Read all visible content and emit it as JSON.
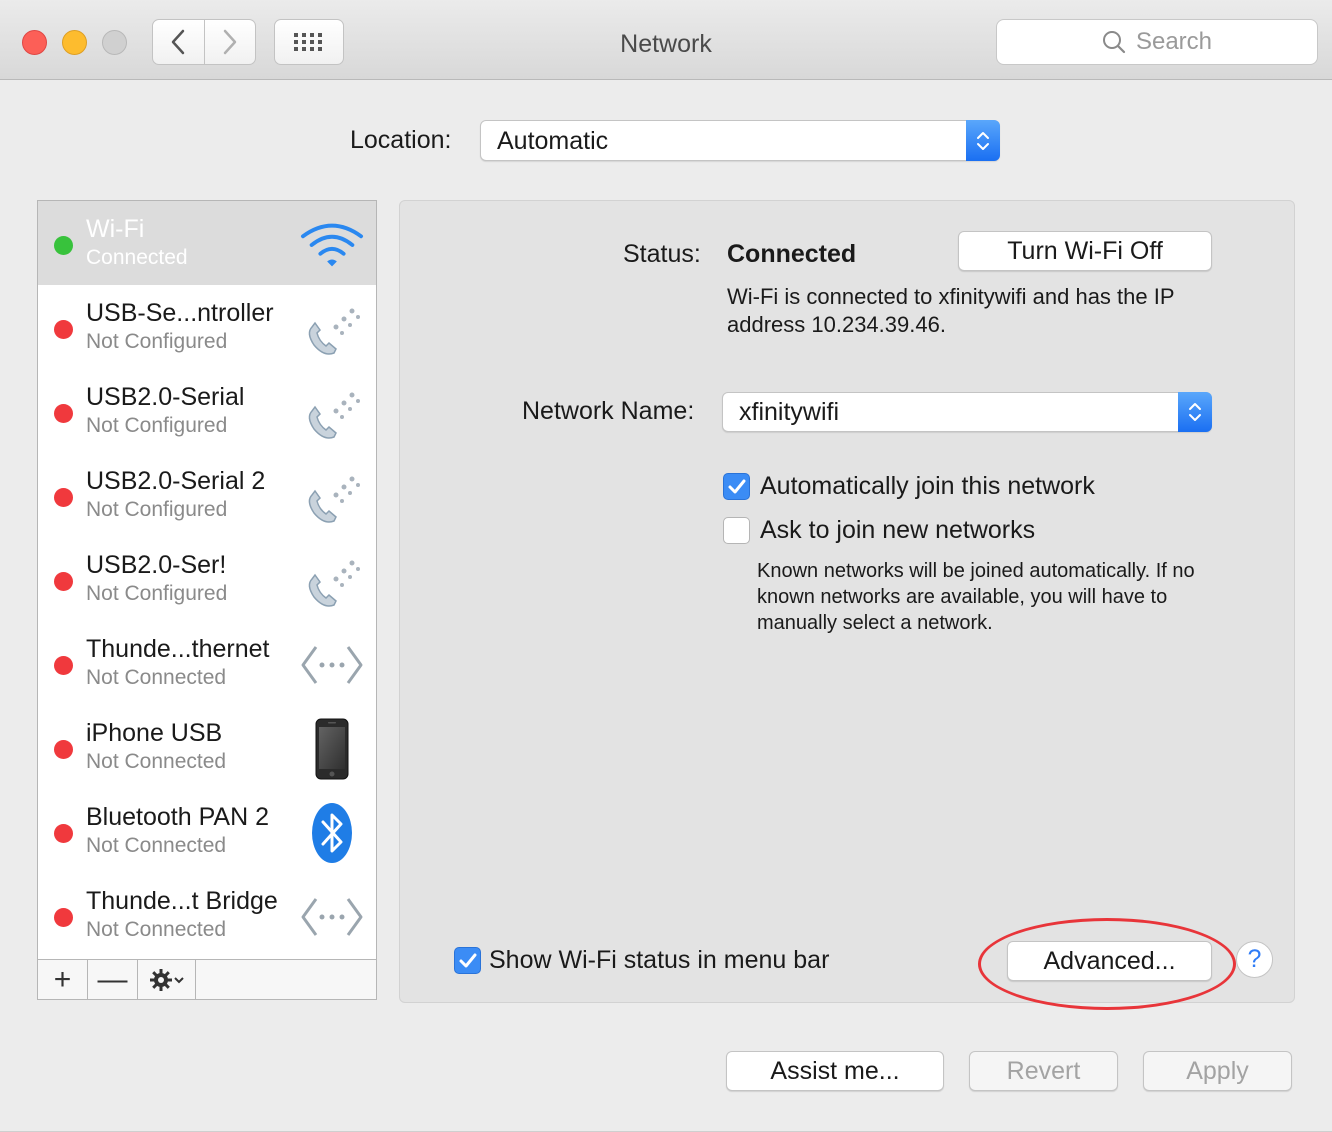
{
  "window": {
    "title": "Network",
    "search_placeholder": "Search"
  },
  "location": {
    "label": "Location:",
    "value": "Automatic"
  },
  "services": [
    {
      "name": "Wi-Fi",
      "status": "Connected",
      "dot": "green",
      "icon": "wifi-icon",
      "selected": true
    },
    {
      "name": "USB-Se...ntroller",
      "status": "Not Configured",
      "dot": "red",
      "icon": "phone-modem-icon"
    },
    {
      "name": "USB2.0-Serial",
      "status": "Not Configured",
      "dot": "red",
      "icon": "phone-modem-icon"
    },
    {
      "name": "USB2.0-Serial 2",
      "status": "Not Configured",
      "dot": "red",
      "icon": "phone-modem-icon"
    },
    {
      "name": "USB2.0-Ser!",
      "status": "Not Configured",
      "dot": "red",
      "icon": "phone-modem-icon"
    },
    {
      "name": "Thunde...thernet",
      "status": "Not Connected",
      "dot": "red",
      "icon": "ethernet-icon"
    },
    {
      "name": "iPhone USB",
      "status": "Not Connected",
      "dot": "red",
      "icon": "iphone-icon"
    },
    {
      "name": "Bluetooth PAN 2",
      "status": "Not Connected",
      "dot": "red",
      "icon": "bluetooth-icon"
    },
    {
      "name": "Thunde...t Bridge",
      "status": "Not Connected",
      "dot": "red",
      "icon": "ethernet-icon"
    }
  ],
  "sidebar_toolbar": {
    "add": "+",
    "remove": "—"
  },
  "detail": {
    "status_label": "Status:",
    "status_value": "Connected",
    "turn_off_button": "Turn Wi-Fi Off",
    "status_description": "Wi-Fi is connected to xfinitywifi and has the IP address 10.234.39.46.",
    "network_name_label": "Network Name:",
    "network_name_value": "xfinitywifi",
    "auto_join_label": "Automatically join this network",
    "auto_join_checked": true,
    "ask_join_label": "Ask to join new networks",
    "ask_join_checked": false,
    "ask_join_help": "Known networks will be joined automatically. If no known networks are available, you will have to manually select a network.",
    "show_status_label": "Show Wi-Fi status in menu bar",
    "show_status_checked": true,
    "advanced_button": "Advanced...",
    "help_button": "?"
  },
  "footer": {
    "assist_button": "Assist me...",
    "revert_button": "Revert",
    "apply_button": "Apply"
  },
  "colors": {
    "accent": "#3b8cf5",
    "status_green": "#38c23c",
    "status_red": "#f0393d",
    "annotation": "#e8353a"
  }
}
